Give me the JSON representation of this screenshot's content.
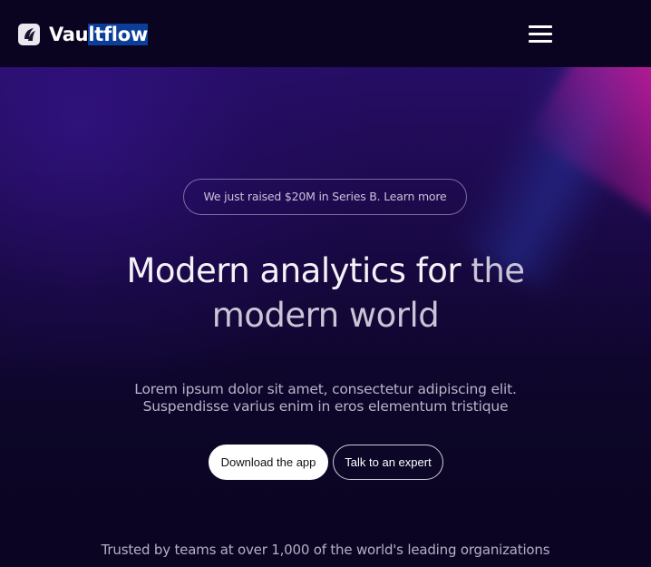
{
  "header": {
    "brand_part1": "Vau",
    "brand_part2": "ltflow",
    "menu_icon": "hamburger-menu-icon",
    "logo_icon": "vaultflow-logo-icon"
  },
  "hero": {
    "announcement": "We just raised $20M in Series B. Learn more",
    "headline_part1": "Modern analytics for ",
    "headline_part2": "the",
    "headline_line2": "modern world",
    "subtext_line1": "Lorem ipsum dolor sit amet, consectetur adipiscing elit.",
    "subtext_line2": "Suspendisse varius enim in eros elementum tristique",
    "primary_button": "Download the app",
    "secondary_button": "Talk to an expert",
    "trusted_text": "Trusted by teams at over 1,000 of the world's leading organizations"
  },
  "colors": {
    "header_bg": "#0a0421",
    "hero_purple": "#280e69",
    "accent_pink": "#d61e8c",
    "selection_blue": "#0b3e98"
  }
}
